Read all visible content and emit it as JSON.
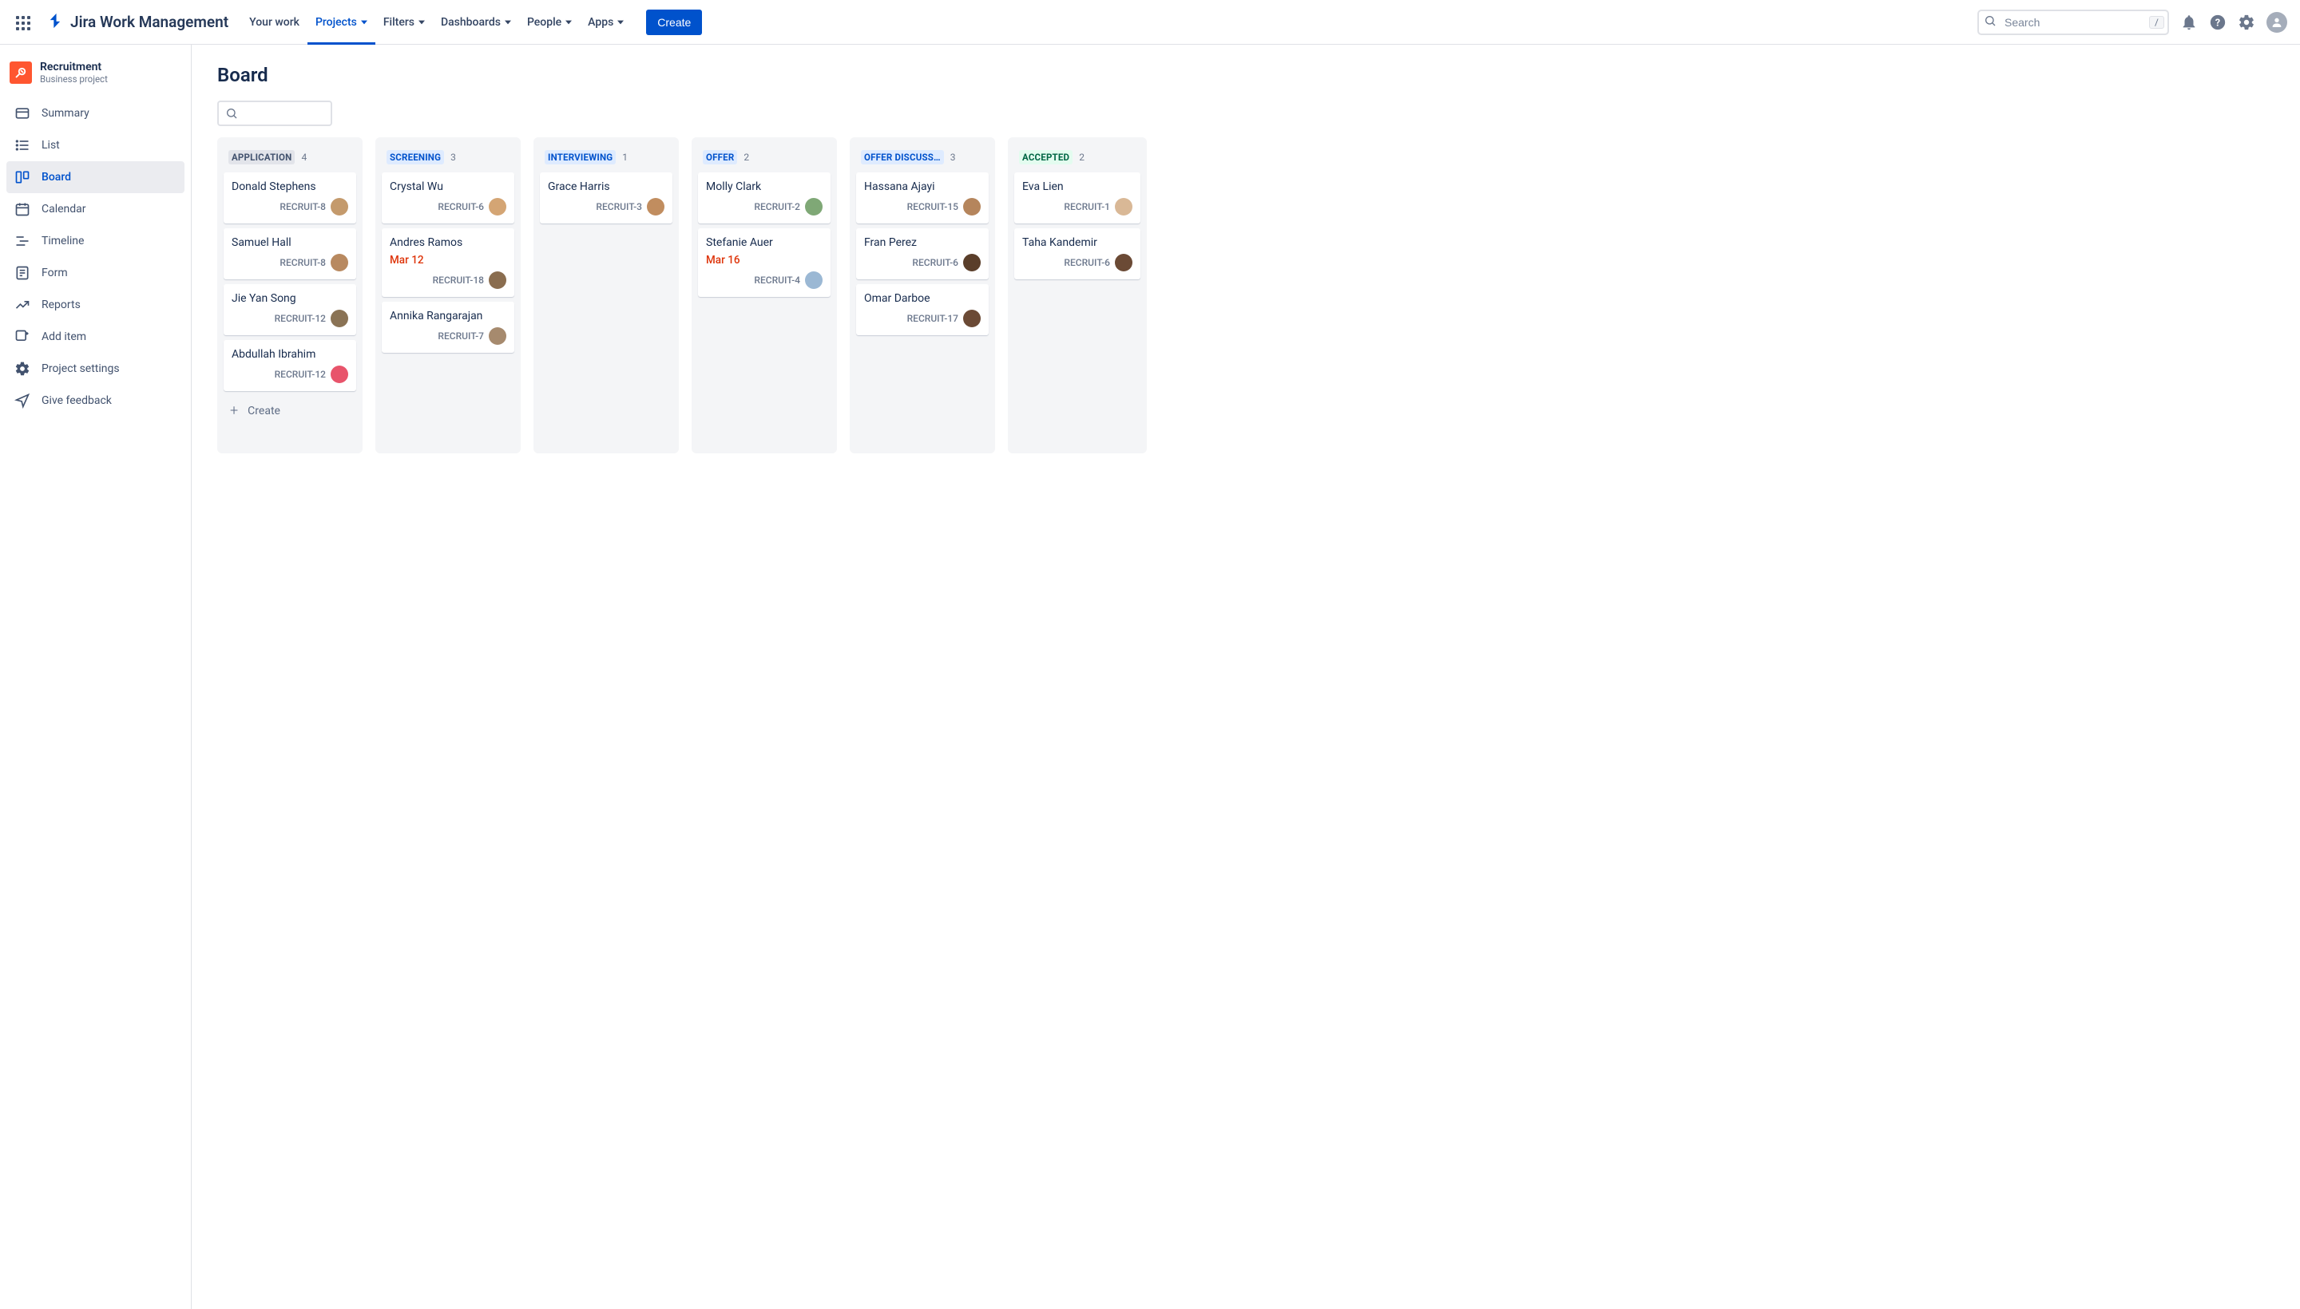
{
  "app": {
    "product_name": "Jira Work Management"
  },
  "topnav": {
    "items": [
      {
        "label": "Your work",
        "dropdown": false
      },
      {
        "label": "Projects",
        "dropdown": true,
        "active": true
      },
      {
        "label": "Filters",
        "dropdown": true
      },
      {
        "label": "Dashboards",
        "dropdown": true
      },
      {
        "label": "People",
        "dropdown": true
      },
      {
        "label": "Apps",
        "dropdown": true
      }
    ],
    "create_label": "Create",
    "search_placeholder": "Search",
    "slash_hint": "/"
  },
  "project": {
    "name": "Recruitment",
    "subtitle": "Business project"
  },
  "sidebar": {
    "items": [
      {
        "label": "Summary",
        "icon": "card"
      },
      {
        "label": "List",
        "icon": "list"
      },
      {
        "label": "Board",
        "icon": "board",
        "active": true
      },
      {
        "label": "Calendar",
        "icon": "calendar"
      },
      {
        "label": "Timeline",
        "icon": "timeline"
      },
      {
        "label": "Form",
        "icon": "form"
      },
      {
        "label": "Reports",
        "icon": "reports"
      },
      {
        "label": "Add item",
        "icon": "add"
      },
      {
        "label": "Project settings",
        "icon": "gear"
      },
      {
        "label": "Give feedback",
        "icon": "feedback"
      }
    ]
  },
  "page": {
    "title": "Board",
    "create_card_label": "Create"
  },
  "board": {
    "columns": [
      {
        "title": "APPLICATION",
        "count": 4,
        "status": "gray",
        "cards": [
          {
            "name": "Donald Stephens",
            "key": "RECRUIT-8",
            "avatar": "#c49a6c"
          },
          {
            "name": "Samuel Hall",
            "key": "RECRUIT-8",
            "avatar": "#b88960"
          },
          {
            "name": "Jie Yan Song",
            "key": "RECRUIT-12",
            "avatar": "#8a7355"
          },
          {
            "name": "Abdullah Ibrahim",
            "key": "RECRUIT-12",
            "avatar": "#e8546b"
          }
        ],
        "show_create": true
      },
      {
        "title": "SCREENING",
        "count": 3,
        "status": "blue",
        "cards": [
          {
            "name": "Crystal Wu",
            "key": "RECRUIT-6",
            "avatar": "#d4a574"
          },
          {
            "name": "Andres Ramos",
            "key": "RECRUIT-18",
            "date": "Mar 12",
            "avatar": "#8a6d4f"
          },
          {
            "name": "Annika Rangarajan",
            "key": "RECRUIT-7",
            "avatar": "#a68a6e"
          }
        ]
      },
      {
        "title": "INTERVIEWING",
        "count": 1,
        "status": "blue",
        "cards": [
          {
            "name": "Grace Harris",
            "key": "RECRUIT-3",
            "avatar": "#c18d5f"
          }
        ]
      },
      {
        "title": "OFFER",
        "count": 2,
        "status": "blue",
        "cards": [
          {
            "name": "Molly Clark",
            "key": "RECRUIT-2",
            "avatar": "#7fa876"
          },
          {
            "name": "Stefanie Auer",
            "key": "RECRUIT-4",
            "date": "Mar 16",
            "avatar": "#9bb8d4"
          }
        ]
      },
      {
        "title": "OFFER DISCUSS…",
        "count": 3,
        "status": "blue",
        "cards": [
          {
            "name": "Hassana Ajayi",
            "key": "RECRUIT-15",
            "avatar": "#b5855c"
          },
          {
            "name": "Fran Perez",
            "key": "RECRUIT-6",
            "avatar": "#5a3e2a"
          },
          {
            "name": "Omar Darboe",
            "key": "RECRUIT-17",
            "avatar": "#6b4a35"
          }
        ]
      },
      {
        "title": "ACCEPTED",
        "count": 2,
        "status": "green",
        "last": true,
        "cards": [
          {
            "name": "Eva Lien",
            "key": "RECRUIT-1",
            "avatar": "#d9b896"
          },
          {
            "name": "Taha Kandemir",
            "key": "RECRUIT-6",
            "avatar": "#6b4a35"
          }
        ]
      }
    ]
  }
}
